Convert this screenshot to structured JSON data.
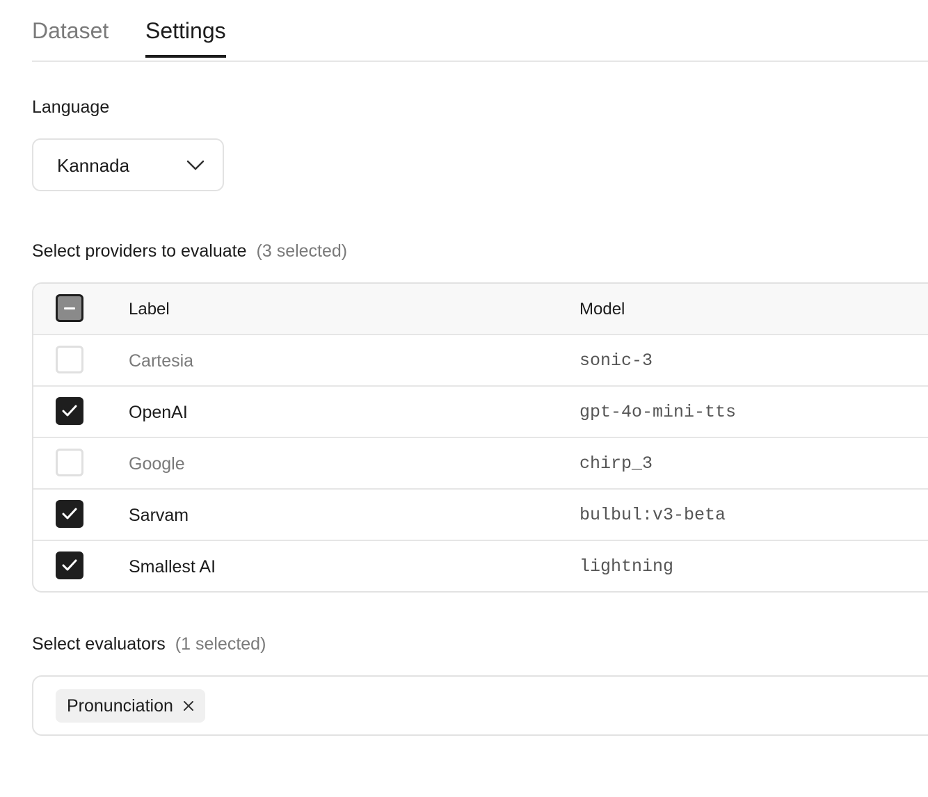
{
  "tabs": [
    {
      "label": "Dataset",
      "active": false
    },
    {
      "label": "Settings",
      "active": true
    }
  ],
  "language": {
    "label": "Language",
    "selected": "Kannada"
  },
  "providers": {
    "title": "Select providers to evaluate",
    "count_text": "(3 selected)",
    "columns": {
      "label": "Label",
      "model": "Model"
    },
    "header_checkbox_state": "indeterminate",
    "rows": [
      {
        "label": "Cartesia",
        "model": "sonic-3",
        "selected": false
      },
      {
        "label": "OpenAI",
        "model": "gpt-4o-mini-tts",
        "selected": true
      },
      {
        "label": "Google",
        "model": "chirp_3",
        "selected": false
      },
      {
        "label": "Sarvam",
        "model": "bulbul:v3-beta",
        "selected": true
      },
      {
        "label": "Smallest AI",
        "model": "lightning",
        "selected": true
      }
    ]
  },
  "evaluators": {
    "title": "Select evaluators",
    "count_text": "(1 selected)",
    "chips": [
      {
        "label": "Pronunciation"
      }
    ]
  },
  "colors": {
    "text": "#1c1c1c",
    "muted": "#7a7a7a",
    "checkbox_checked": "#1e1e1e",
    "border": "#e2e2e2"
  }
}
